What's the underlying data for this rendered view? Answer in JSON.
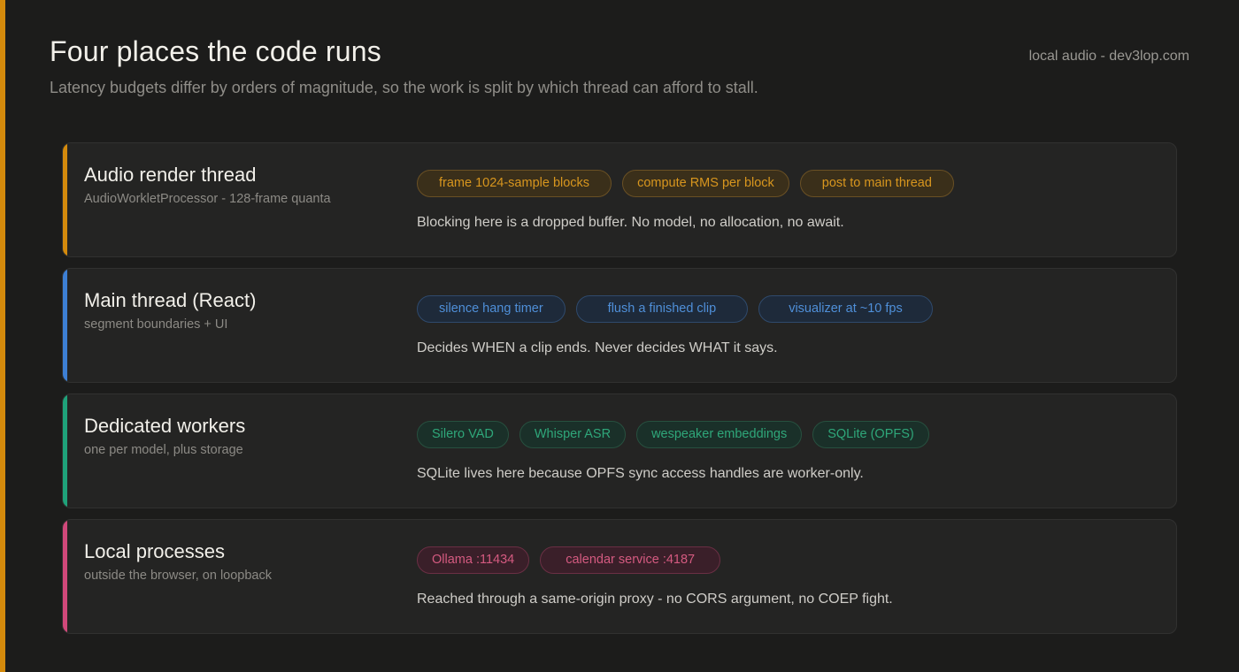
{
  "header": {
    "title": "Four places the code runs",
    "subtitle": "Latency budgets differ by orders of magnitude, so the work is split by which thread can afford to stall.",
    "brand": "local audio - dev3lop.com"
  },
  "colors": {
    "accent_left": "#d48a0c",
    "orange": "#d48a0c",
    "blue": "#3d7fd4",
    "green": "#1fa27a",
    "pink": "#d0487a"
  },
  "rows": [
    {
      "name": "Audio render thread",
      "sub": "AudioWorkletProcessor - 128-frame quanta",
      "chips": [
        "frame 1024-sample blocks",
        "compute RMS per block",
        "post to main thread"
      ],
      "note": "Blocking here is a dropped buffer. No model, no allocation, no await."
    },
    {
      "name": "Main thread (React)",
      "sub": "segment boundaries + UI",
      "chips": [
        "silence hang timer",
        "flush a finished clip",
        "visualizer at ~10 fps"
      ],
      "note": "Decides WHEN a clip ends. Never decides WHAT it says."
    },
    {
      "name": "Dedicated workers",
      "sub": "one per model, plus storage",
      "chips": [
        "Silero VAD",
        "Whisper ASR",
        "wespeaker embeddings",
        "SQLite (OPFS)"
      ],
      "note": "SQLite lives here because OPFS sync access handles are worker-only."
    },
    {
      "name": "Local processes",
      "sub": "outside the browser, on loopback",
      "chips": [
        "Ollama :11434",
        "calendar service :4187"
      ],
      "note": "Reached through a same-origin proxy - no CORS argument, no COEP fight."
    }
  ]
}
